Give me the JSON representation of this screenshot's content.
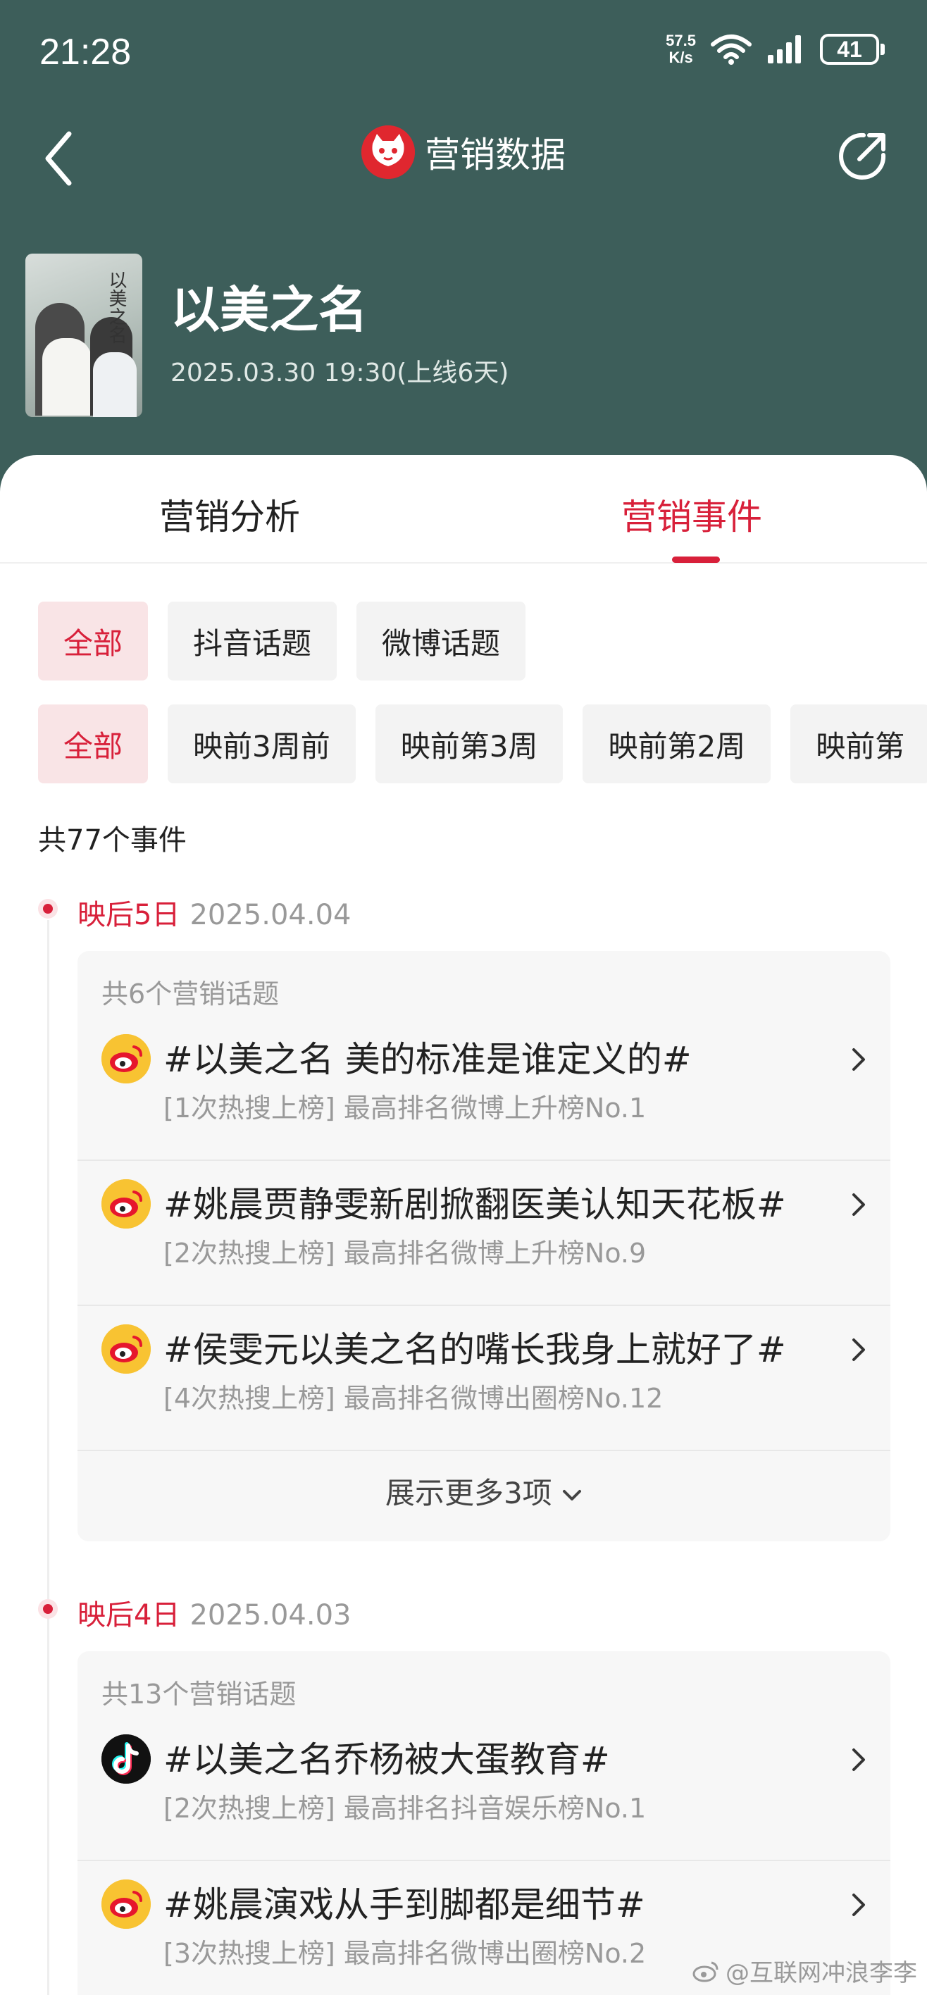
{
  "status_bar": {
    "time": "21:28",
    "net_speed_value": "57.5",
    "net_speed_unit": "K/s",
    "battery": "41",
    "icons": [
      "wifi-icon",
      "signal-icon",
      "battery-icon"
    ]
  },
  "header": {
    "title": "营销数据",
    "back_icon": "back-icon",
    "share_icon": "share-icon",
    "logo_icon": "cat-logo-icon"
  },
  "movie": {
    "title": "以美之名",
    "date": "2025.03.30 19:30(上线6天)",
    "poster_text": "以美之名"
  },
  "tabs": [
    {
      "label": "营销分析",
      "active": false
    },
    {
      "label": "营销事件",
      "active": true
    }
  ],
  "platform_filters": [
    "全部",
    "抖音话题",
    "微博话题"
  ],
  "time_filters": [
    "全部",
    "映前3周前",
    "映前第3周",
    "映前第2周",
    "映前第"
  ],
  "total": "共77个事件",
  "events": [
    {
      "day": "映后5日",
      "date": "2025.04.04",
      "count_label": "共6个营销话题",
      "topics": [
        {
          "platform": "weibo",
          "title": "#以美之名 美的标准是谁定义的#",
          "sub": "[1次热搜上榜] 最高排名微博上升榜No.1"
        },
        {
          "platform": "weibo",
          "title": "#姚晨贾静雯新剧掀翻医美认知天花板#",
          "sub": "[2次热搜上榜] 最高排名微博上升榜No.9"
        },
        {
          "platform": "weibo",
          "title": "#侯雯元以美之名的嘴长我身上就好了#",
          "sub": "[4次热搜上榜] 最高排名微博出圈榜No.12"
        }
      ],
      "show_more": "展示更多3项"
    },
    {
      "day": "映后4日",
      "date": "2025.04.03",
      "count_label": "共13个营销话题",
      "topics": [
        {
          "platform": "douyin",
          "title": "#以美之名乔杨被大蛋教育#",
          "sub": "[2次热搜上榜] 最高排名抖音娱乐榜No.1"
        },
        {
          "platform": "weibo",
          "title": "#姚晨演戏从手到脚都是细节#",
          "sub": "[3次热搜上榜] 最高排名微博出圈榜No.2"
        }
      ]
    }
  ],
  "watermark": "@互联网冲浪李李",
  "colors": {
    "header_bg": "#3d5e5a",
    "accent": "#d8203a",
    "weibo": "#f8c332",
    "douyin": "#111111"
  }
}
